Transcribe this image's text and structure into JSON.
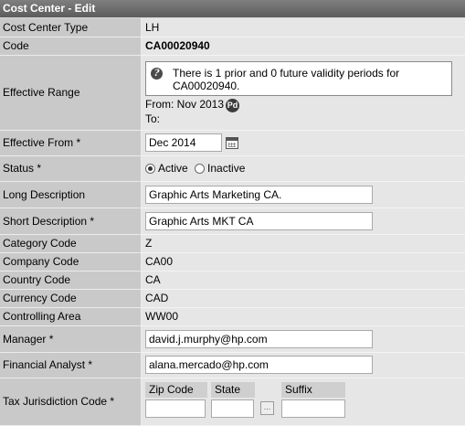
{
  "header": {
    "title": "Cost Center - Edit"
  },
  "fields": {
    "cost_center_type": {
      "label": "Cost Center Type",
      "value": "LH"
    },
    "code": {
      "label": "Code",
      "value": "CA00020940"
    },
    "effective_range": {
      "label": "Effective Range",
      "info_line1": "There is 1 prior and 0 future validity periods for",
      "info_line2": "CA00020940.",
      "from": "From: Nov 2013",
      "pd_badge": "Pd",
      "to": "To:"
    },
    "effective_from": {
      "label": "Effective From *",
      "value": "Dec 2014"
    },
    "status": {
      "label": "Status *",
      "options": [
        "Active",
        "Inactive"
      ],
      "selected": "Active"
    },
    "long_description": {
      "label": "Long Description",
      "value": "Graphic Arts Marketing CA."
    },
    "short_description": {
      "label": "Short Description *",
      "value": "Graphic Arts MKT CA"
    },
    "category_code": {
      "label": "Category Code",
      "value": "Z"
    },
    "company_code": {
      "label": "Company Code",
      "value": "CA00"
    },
    "country_code": {
      "label": "Country Code",
      "value": "CA"
    },
    "currency_code": {
      "label": "Currency Code",
      "value": "CAD"
    },
    "controlling_area": {
      "label": "Controlling Area",
      "value": "WW00"
    },
    "manager": {
      "label": "Manager *",
      "value": "david.j.murphy@hp.com"
    },
    "financial_analyst": {
      "label": "Financial Analyst *",
      "value": "alana.mercado@hp.com"
    },
    "tax_jurisdiction": {
      "label": "Tax Jurisdiction Code *",
      "zip_label": "Zip Code",
      "zip_value": "",
      "state_label": "State",
      "state_value": "",
      "lookup_label": "...",
      "suffix_label": "Suffix",
      "suffix_value": ""
    }
  }
}
